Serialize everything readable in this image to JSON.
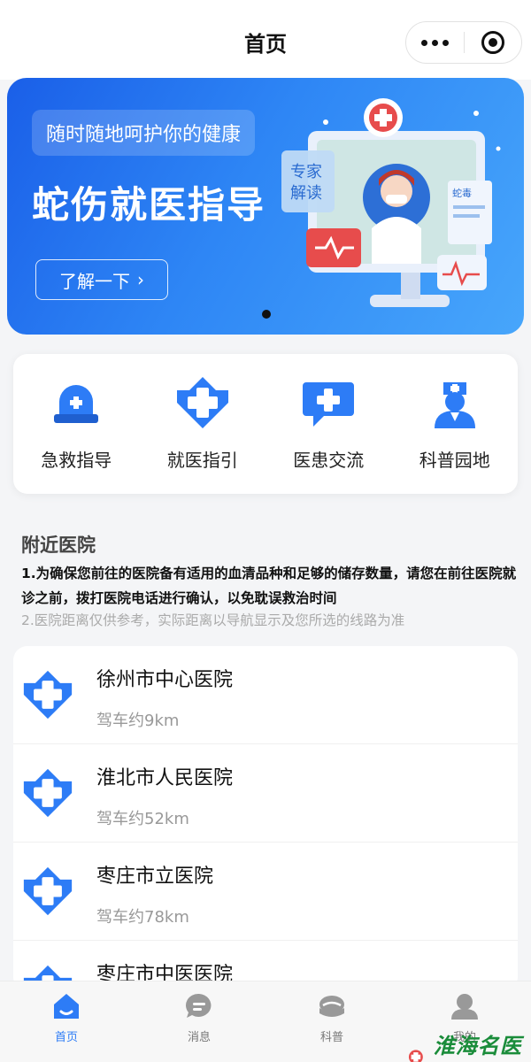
{
  "header": {
    "title": "首页"
  },
  "banner": {
    "tagline": "随时随地呵护你的健康",
    "headline": "蛇伤就医指导",
    "button_label": "了解一下",
    "button_chevron": "›",
    "illustration_badge_1": "专家",
    "illustration_badge_2": "解读",
    "illustration_note": "蛇毒"
  },
  "quick_menu": [
    {
      "label": "急救指导",
      "icon": "siren-icon"
    },
    {
      "label": "就医指引",
      "icon": "medical-cross-icon"
    },
    {
      "label": "医患交流",
      "icon": "chat-plus-icon"
    },
    {
      "label": "科普园地",
      "icon": "nurse-icon"
    }
  ],
  "nearby": {
    "title": "附近医院",
    "note1": "1.为确保您前往的医院备有适用的血清品种和足够的储存数量，请您在前往医院就诊之前，拨打医院电话进行确认，以免耽误救治时间",
    "note2": "2.医院距离仅供参考，实际距离以导航显示及您所选的线路为准",
    "hospitals": [
      {
        "name": "徐州市中心医院",
        "distance": "驾车约9km"
      },
      {
        "name": "淮北市人民医院",
        "distance": "驾车约52km"
      },
      {
        "name": "枣庄市立医院",
        "distance": "驾车约78km"
      },
      {
        "name": "枣庄市中医医院",
        "distance": ""
      }
    ]
  },
  "tabbar": [
    {
      "label": "首页",
      "icon": "home-icon",
      "active": true
    },
    {
      "label": "消息",
      "icon": "message-icon",
      "active": false
    },
    {
      "label": "科普",
      "icon": "science-icon",
      "active": false
    },
    {
      "label": "我的",
      "icon": "profile-icon",
      "active": false
    }
  ],
  "watermark": {
    "text": "淮海名医网"
  },
  "colors": {
    "primary": "#2d7cf6",
    "banner_start": "#1a5fe8",
    "banner_end": "#47a6fb"
  }
}
